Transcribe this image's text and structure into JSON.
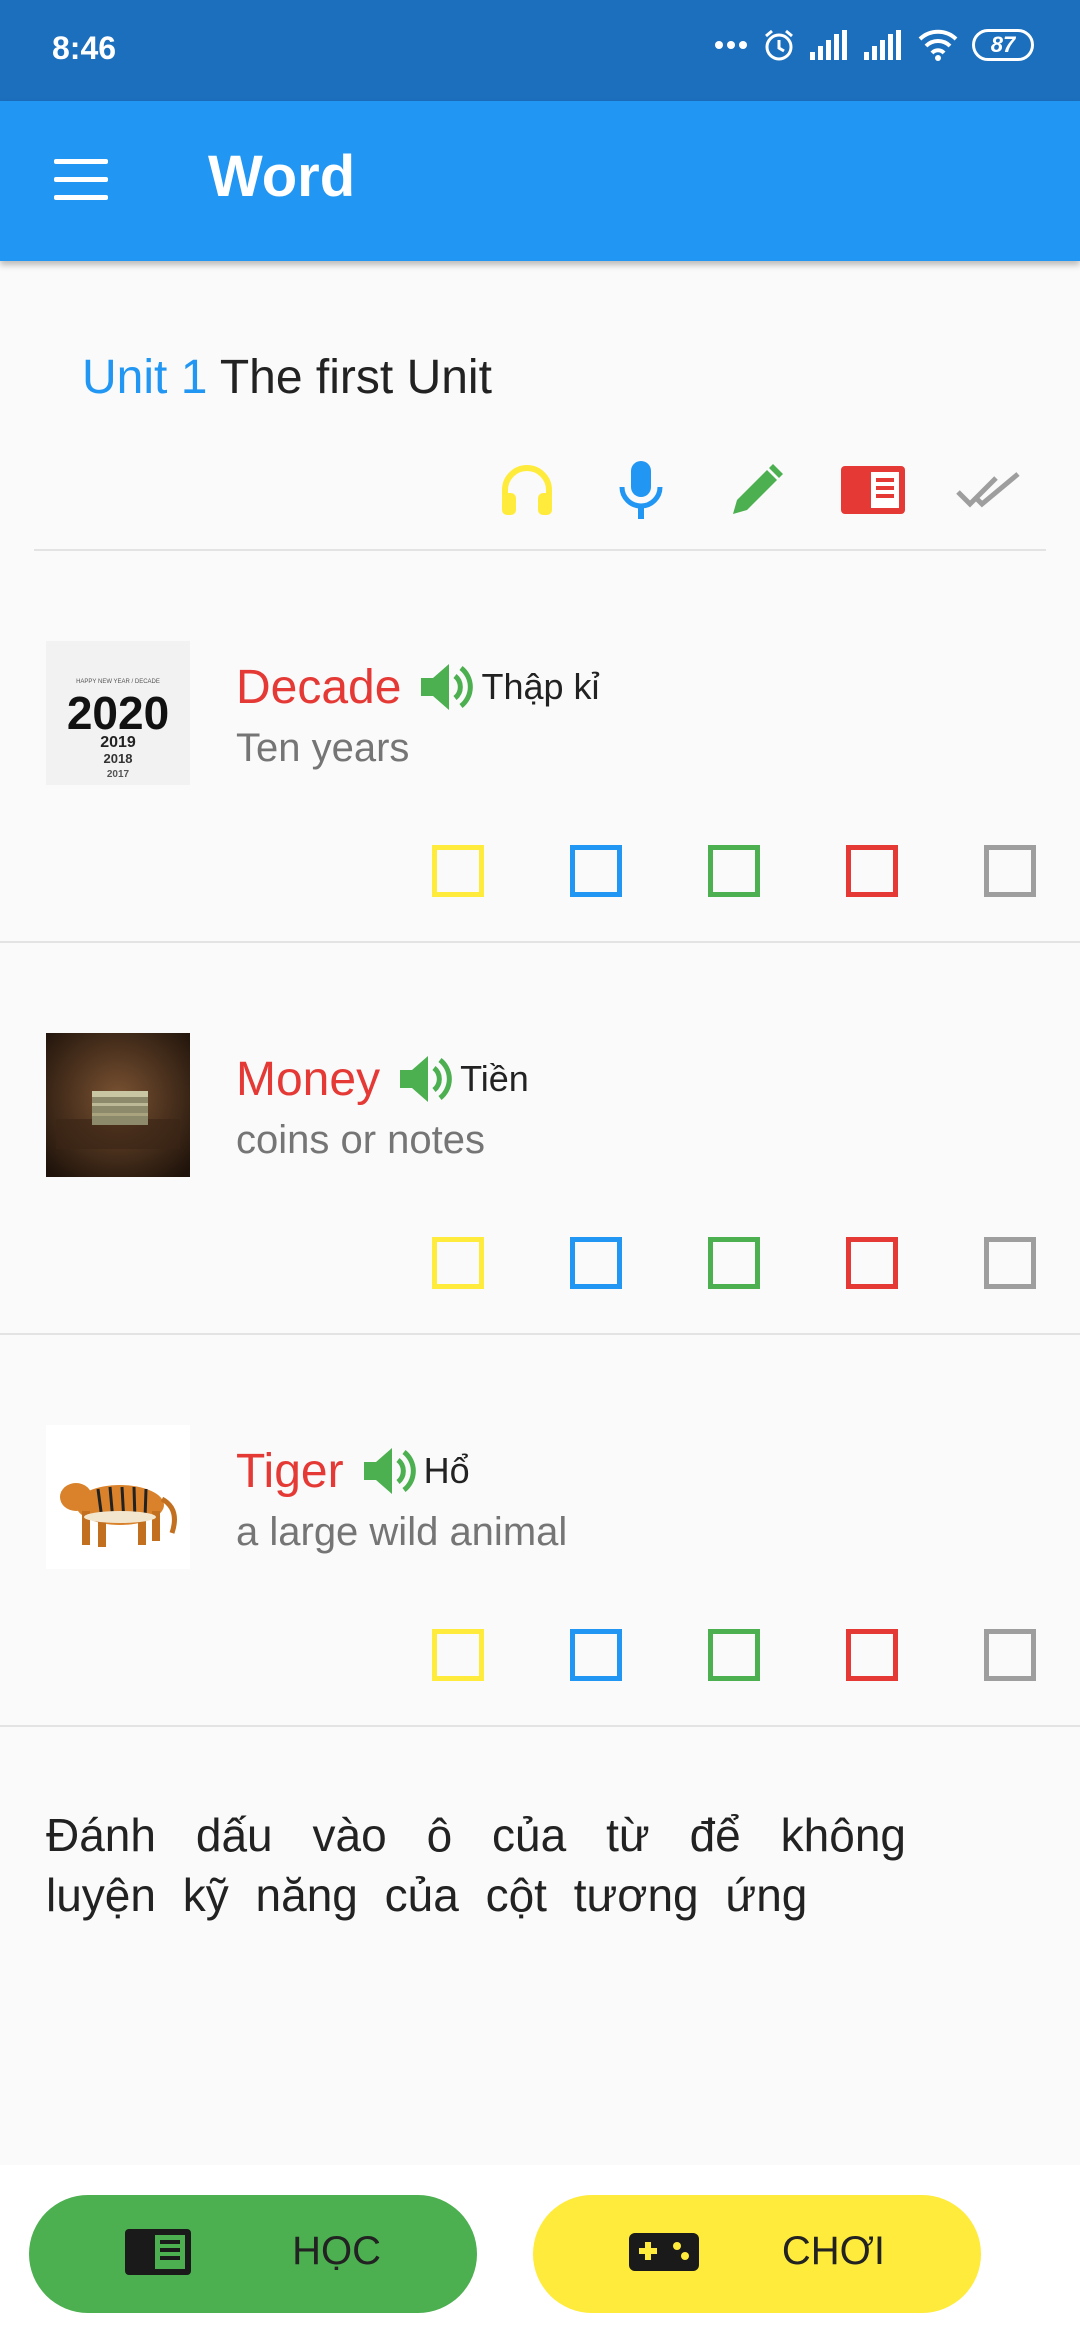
{
  "status_bar": {
    "time": "8:46",
    "battery": "87"
  },
  "app_bar": {
    "title": "Word"
  },
  "unit": {
    "number_label": "Unit 1",
    "name": "The first Unit"
  },
  "column_icons": [
    {
      "icon": "headphones-icon",
      "color": "#ffeb3b"
    },
    {
      "icon": "microphone-icon",
      "color": "#2196f3"
    },
    {
      "icon": "pencil-icon",
      "color": "#4caf50"
    },
    {
      "icon": "book-icon",
      "color": "#e53935"
    },
    {
      "icon": "double-check-icon",
      "color": "#9e9e9e"
    }
  ],
  "checkbox_colors": [
    "#ffeb3b",
    "#2196f3",
    "#4caf50",
    "#e53935",
    "#9e9e9e"
  ],
  "words": [
    {
      "word": "Decade",
      "meaning": "Thập kỉ",
      "definition": "Ten years",
      "image": "2020 calendar image",
      "image_text": {
        "caption": "HAPPY NEW YEAR / DECADE",
        "year": "2020",
        "y1": "2019",
        "y2": "2018",
        "y3": "2017"
      }
    },
    {
      "word": "Money",
      "meaning": "Tiền",
      "definition": "coins or notes",
      "image": "stack of money image"
    },
    {
      "word": "Tiger",
      "meaning": "Hổ",
      "definition": "a large wild animal",
      "image": "tiger image"
    }
  ],
  "hint": "Đánh dấu vào ô của từ để không luyện kỹ năng của cột tương ứng",
  "bottom": {
    "learn": {
      "label": "HỌC",
      "icon": "book-icon",
      "color": "#4caf50"
    },
    "play": {
      "label": "CHƠI",
      "icon": "gamepad-icon",
      "color": "#ffeb3b"
    }
  }
}
